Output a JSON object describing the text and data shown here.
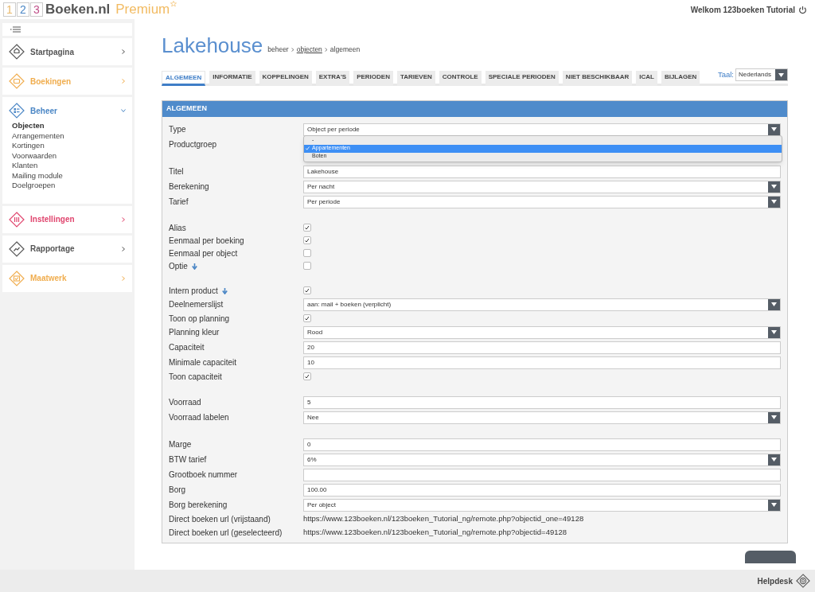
{
  "header": {
    "logo_digits": [
      {
        "text": "1",
        "color": "#e8b86a"
      },
      {
        "text": "2",
        "color": "#4a86c5"
      },
      {
        "text": "3",
        "color": "#c0508a"
      }
    ],
    "logo_name": "Boeken.nl",
    "edition": "Premium",
    "welcome": "Welkom 123boeken Tutorial"
  },
  "sidebar": {
    "items": [
      {
        "label": "Startpagina",
        "color": "#555555",
        "expanded": false
      },
      {
        "label": "Boekingen",
        "color": "#f0ad4e",
        "expanded": false
      },
      {
        "label": "Beheer",
        "color": "#4a86c5",
        "expanded": true,
        "children": [
          {
            "label": "Objecten",
            "selected": true
          },
          {
            "label": "Arrangementen",
            "selected": false
          },
          {
            "label": "Kortingen",
            "selected": false
          },
          {
            "label": "Voorwaarden",
            "selected": false
          },
          {
            "label": "Klanten",
            "selected": false
          },
          {
            "label": "Mailing module",
            "selected": false
          },
          {
            "label": "Doelgroepen",
            "selected": false
          }
        ]
      },
      {
        "label": "Instellingen",
        "color": "#e0456e",
        "expanded": false
      },
      {
        "label": "Rapportage",
        "color": "#555555",
        "expanded": false
      },
      {
        "label": "Maatwerk",
        "color": "#f0ad4e",
        "expanded": false
      }
    ]
  },
  "page": {
    "title": "Lakehouse",
    "breadcrumb": [
      {
        "text": "beheer"
      },
      {
        "text": "objecten",
        "link": true
      },
      {
        "text": "algemeen"
      }
    ]
  },
  "tabs": [
    {
      "label": "ALGEMEEN",
      "selected": true
    },
    {
      "label": "INFORMATIE",
      "selected": false
    },
    {
      "label": "KOPPELINGEN",
      "selected": false
    },
    {
      "label": "EXTRA'S",
      "selected": false
    },
    {
      "label": "PERIODEN",
      "selected": false
    },
    {
      "label": "TARIEVEN",
      "selected": false
    },
    {
      "label": "CONTROLE",
      "selected": false
    },
    {
      "label": "SPECIALE PERIODEN",
      "selected": false
    },
    {
      "label": "NIET BESCHIKBAAR",
      "selected": false
    },
    {
      "label": "ICAL",
      "selected": false
    },
    {
      "label": "BIJLAGEN",
      "selected": false
    }
  ],
  "language": {
    "label": "Taal:",
    "value": "Nederlands"
  },
  "panel": {
    "title": "ALGEMEEN",
    "groups": [
      {
        "rows": [
          {
            "kind": "select",
            "label": "Type",
            "value": "Object per periode",
            "dropdown": [
              {
                "text": "-",
                "selected": false
              },
              {
                "text": "Appartementen",
                "selected": true
              },
              {
                "text": "Boten",
                "selected": false
              }
            ]
          },
          {
            "kind": "hidden",
            "label": "Productgroep"
          }
        ]
      },
      {
        "rows": [
          {
            "kind": "text",
            "label": "Titel",
            "value": "Lakehouse"
          },
          {
            "kind": "select",
            "label": "Berekening",
            "value": "Per nacht"
          },
          {
            "kind": "select",
            "label": "Tarief",
            "value": "Per periode"
          }
        ]
      },
      {
        "rows": [
          {
            "kind": "checkbox",
            "label": "Alias",
            "checked": true
          },
          {
            "kind": "checkbox",
            "label": "Eenmaal per boeking",
            "checked": true
          },
          {
            "kind": "checkbox",
            "label": "Eenmaal per object",
            "checked": false
          },
          {
            "kind": "checkbox",
            "label": "Optie",
            "checked": false,
            "info": true
          }
        ]
      },
      {
        "rows": [
          {
            "kind": "checkbox",
            "label": "Intern product",
            "checked": true,
            "info": true
          },
          {
            "kind": "select",
            "label": "Deelnemerslijst",
            "value": "aan: mail + boeken (verplicht)"
          },
          {
            "kind": "checkbox",
            "label": "Toon op planning",
            "checked": true
          },
          {
            "kind": "select",
            "label": "Planning kleur",
            "value": "Rood"
          },
          {
            "kind": "text",
            "label": "Capaciteit",
            "value": "20"
          },
          {
            "kind": "text",
            "label": "Minimale capaciteit",
            "value": "10"
          },
          {
            "kind": "checkbox",
            "label": "Toon capaciteit",
            "checked": true
          }
        ]
      },
      {
        "rows": [
          {
            "kind": "text",
            "label": "Voorraad",
            "value": "5"
          },
          {
            "kind": "select",
            "label": "Voorraad labelen",
            "value": "Nee"
          }
        ]
      },
      {
        "rows": [
          {
            "kind": "text",
            "label": "Marge",
            "value": "0"
          },
          {
            "kind": "select",
            "label": "BTW tarief",
            "value": "6%"
          },
          {
            "kind": "text",
            "label": "Grootboek nummer"
          },
          {
            "kind": "text",
            "label": "Borg",
            "value": "100.00"
          },
          {
            "kind": "select",
            "label": "Borg berekening",
            "value": "Per object"
          },
          {
            "kind": "url",
            "label": "Direct boeken url (vrijstaand)",
            "value": "https://www.123boeken.nl/123boeken_Tutorial_ng/remote.php?objectid_one=49128"
          },
          {
            "kind": "url",
            "label": "Direct boeken url (geselecteerd)",
            "value": "https://www.123boeken.nl/123boeken_Tutorial_ng/remote.php?objectid=49128"
          }
        ]
      }
    ]
  },
  "footer": {
    "helpdesk": "Helpdesk"
  }
}
